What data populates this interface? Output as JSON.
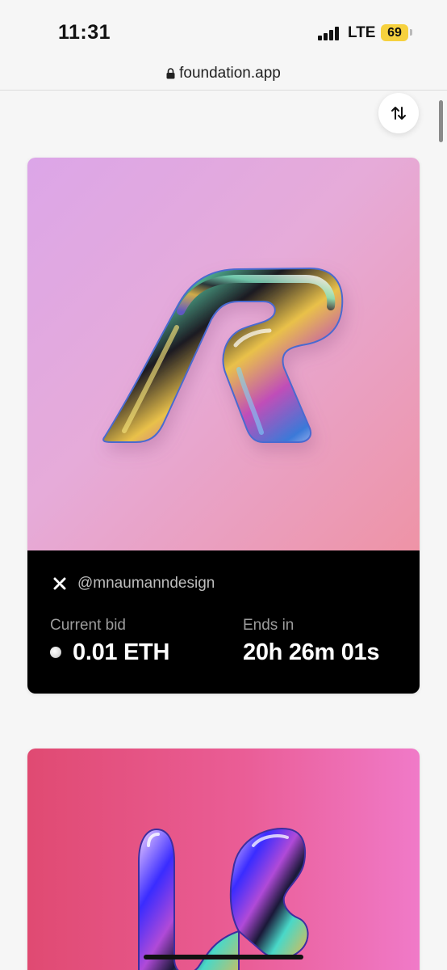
{
  "status_bar": {
    "time": "11:31",
    "network": "LTE",
    "battery": "69",
    "battery_color": "#f6d13e"
  },
  "browser": {
    "url": "foundation.app",
    "lock_icon": "lock-icon"
  },
  "sort_button": {
    "icon": "sort-arrows-icon"
  },
  "cards": [
    {
      "creator": "@mnaumanndesign",
      "creator_icon": "creator-logo-icon",
      "current_bid_label": "Current bid",
      "current_bid_value": "0.01 ETH",
      "ends_in_label": "Ends in",
      "ends_in_value": "20h 26m 01s",
      "artwork": "iridescent-R-sculpture"
    },
    {
      "artwork": "iridescent-letter-sculpture"
    }
  ],
  "colors": {
    "card_info_bg": "#000000",
    "page_bg": "#f6f6f6"
  }
}
